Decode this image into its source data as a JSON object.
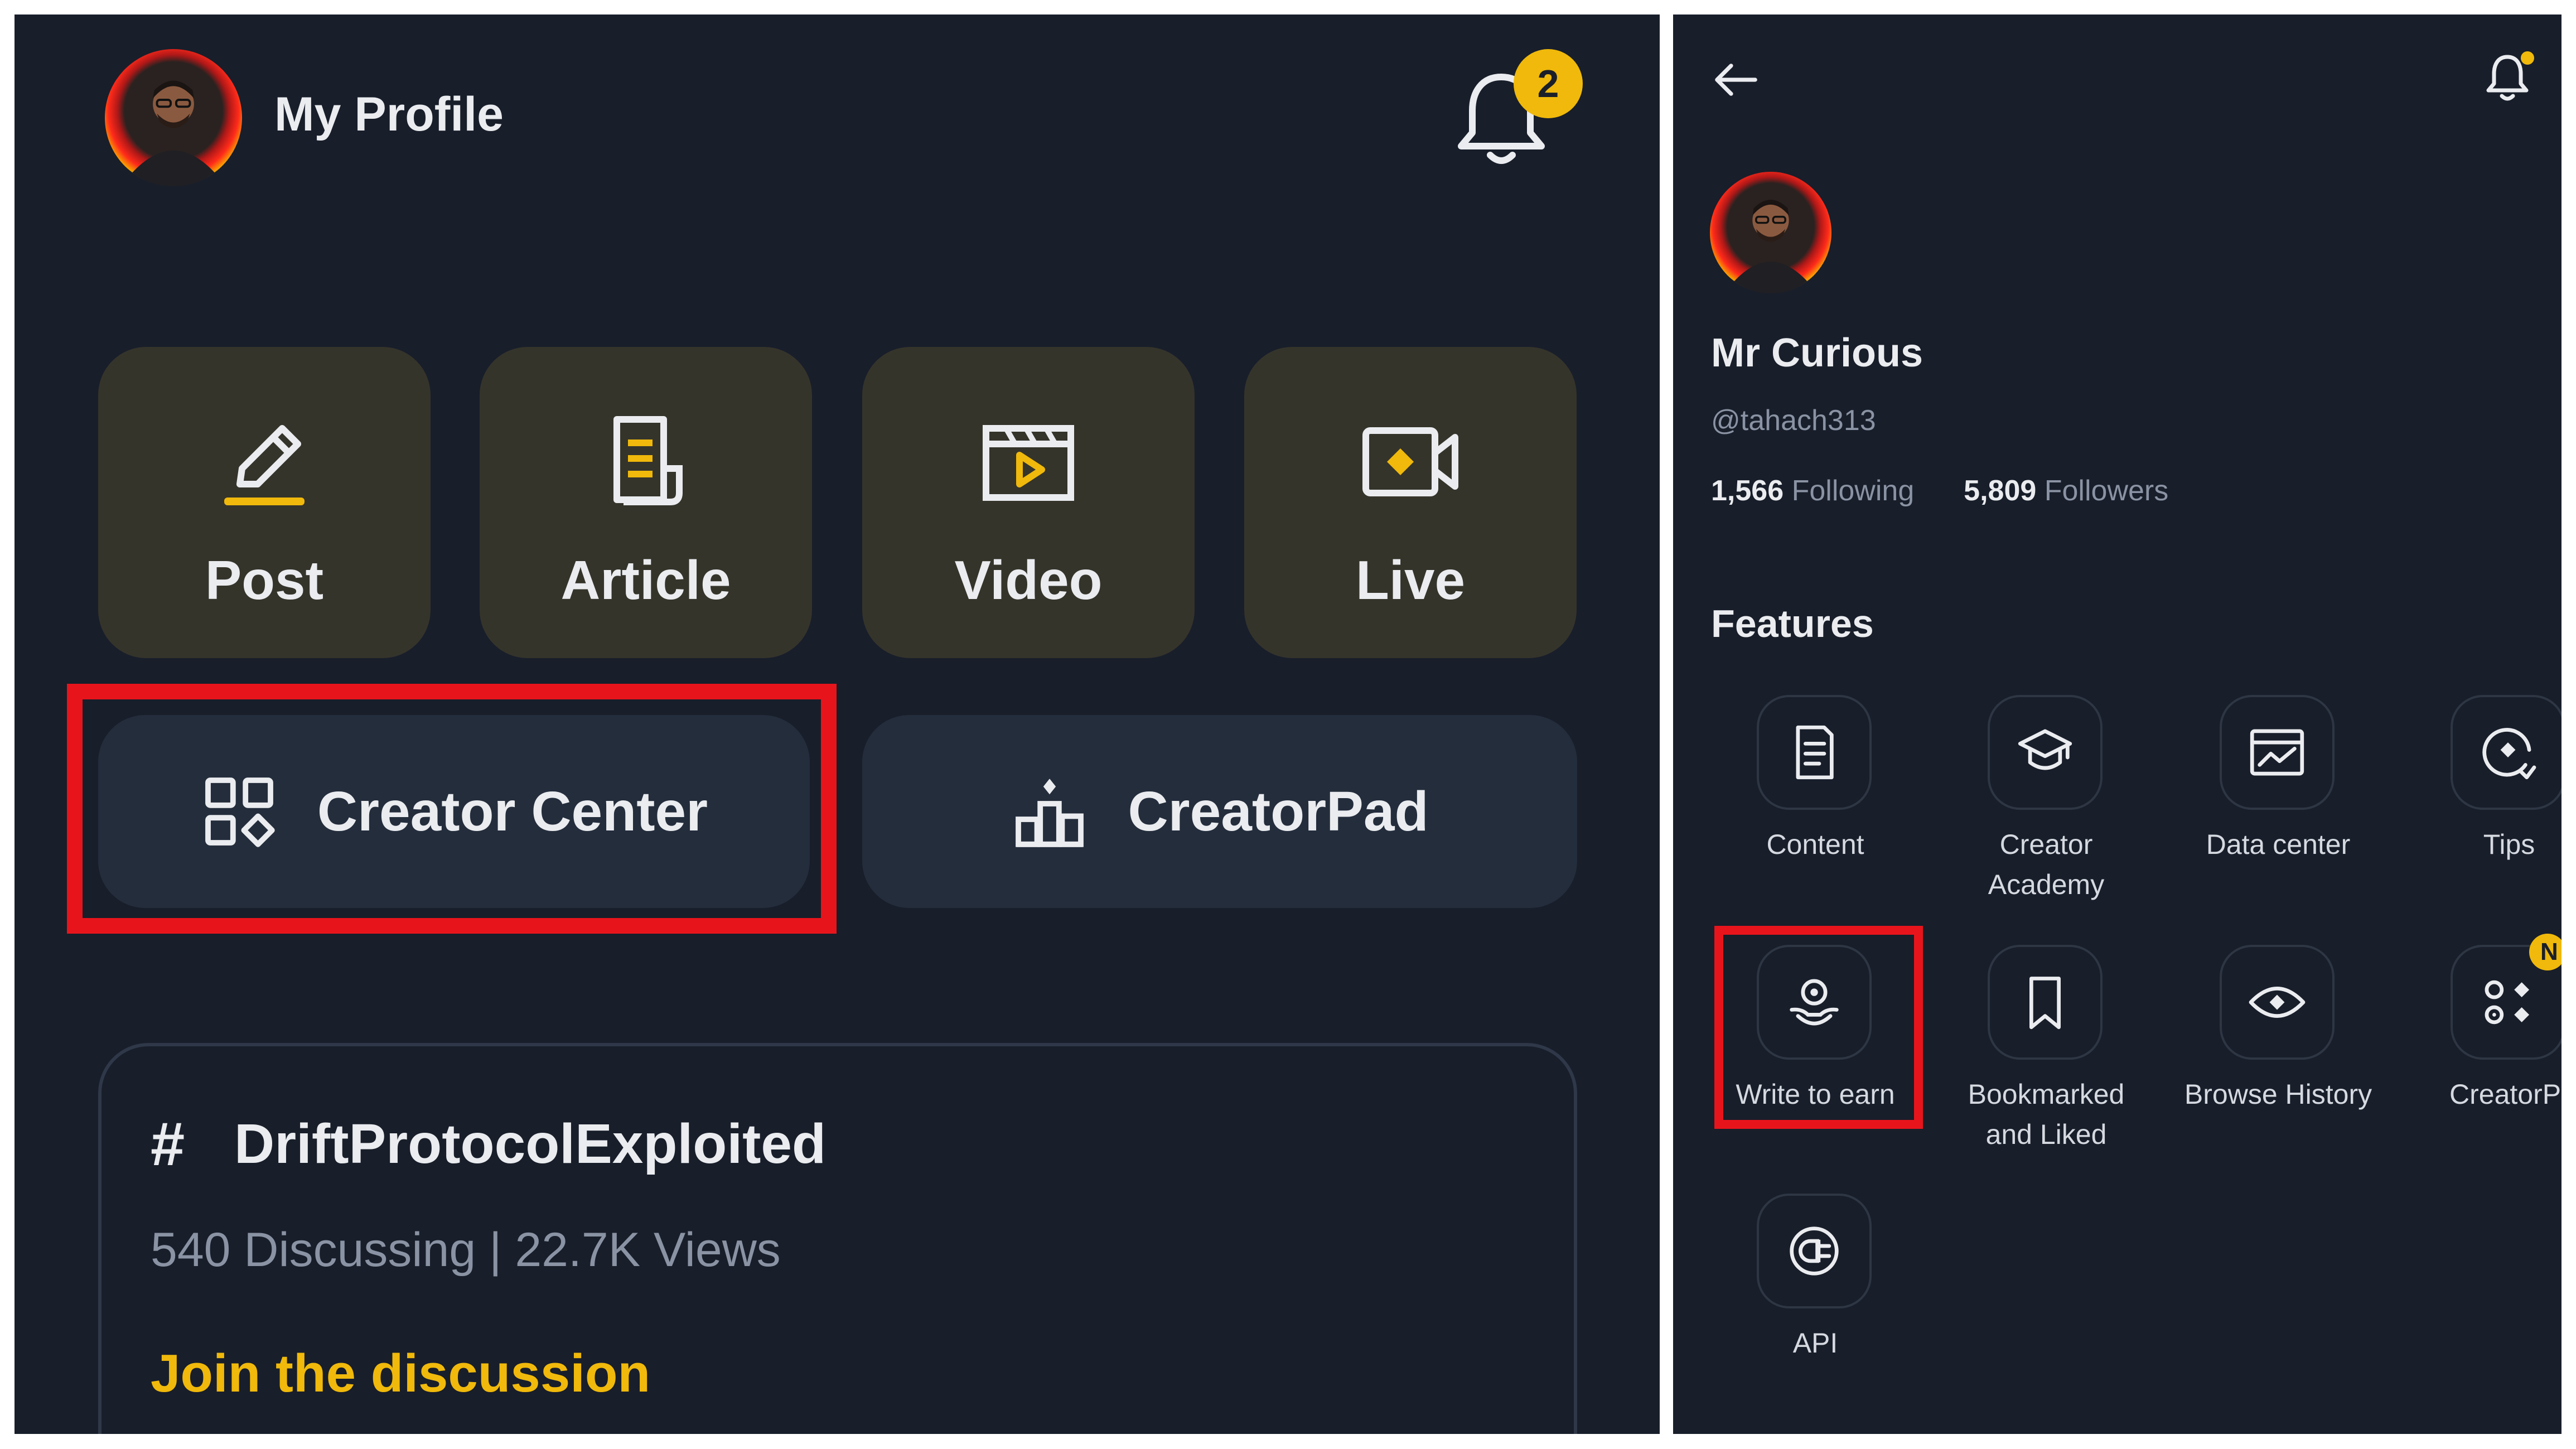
{
  "left_screen": {
    "header": {
      "title": "My Profile",
      "avatar": "profile-avatar",
      "notification_count": "2"
    },
    "actions": [
      {
        "label": "Post",
        "icon": "pencil-icon"
      },
      {
        "label": "Article",
        "icon": "document-icon"
      },
      {
        "label": "Video",
        "icon": "clapperboard-icon"
      },
      {
        "label": "Live",
        "icon": "live-camera-icon"
      }
    ],
    "creator_center": {
      "label": "Creator Center",
      "icon": "grid-icon"
    },
    "creatorpad": {
      "label": "CreatorPad",
      "icon": "podium-icon"
    },
    "topic": {
      "hash": "#",
      "title": "DriftProtocolExploited",
      "stats": "540 Discussing | 22.7K Views",
      "cta": "Join the discussion"
    }
  },
  "right_screen": {
    "profile": {
      "name": "Mr Curious",
      "handle": "@tahach313",
      "following_count": "1,566",
      "following_label": "Following",
      "followers_count": "5,809",
      "followers_label": "Followers"
    },
    "features_title": "Features",
    "features": [
      {
        "label": "Content",
        "icon": "content-icon"
      },
      {
        "label": "Creator Academy",
        "icon": "graduation-cap-icon"
      },
      {
        "label": "Data center",
        "icon": "chart-icon"
      },
      {
        "label": "Tips",
        "icon": "tips-icon"
      },
      {
        "label": "Write to earn",
        "icon": "write-to-earn-icon"
      },
      {
        "label": "Bookmarked and Liked",
        "icon": "bookmark-icon"
      },
      {
        "label": "Browse History",
        "icon": "eye-icon"
      },
      {
        "label": "CreatorPa",
        "icon": "creatorpad-icon",
        "badge": "N"
      },
      {
        "label": "API",
        "icon": "api-icon"
      }
    ]
  },
  "colors": {
    "background": "#181e2a",
    "tile": "#35342b",
    "button": "#242d3c",
    "accent": "#f0b90b",
    "highlight": "#e8141c",
    "text": "#eaecef",
    "muted": "#8a93a3"
  }
}
